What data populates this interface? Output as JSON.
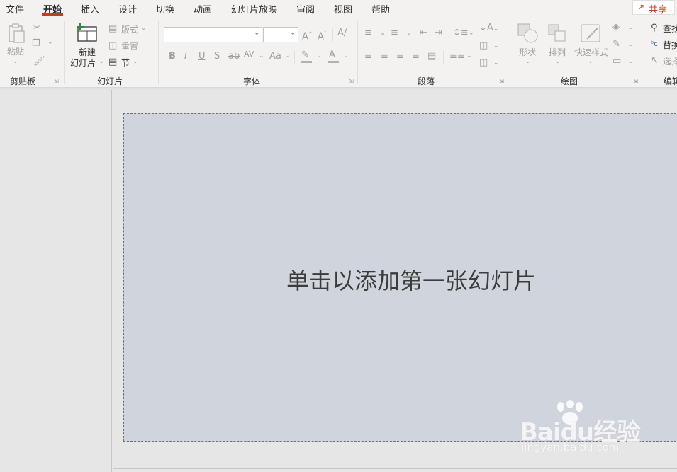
{
  "menu": {
    "tabs": [
      {
        "label": "文件"
      },
      {
        "label": "开始"
      },
      {
        "label": "插入"
      },
      {
        "label": "设计"
      },
      {
        "label": "切换"
      },
      {
        "label": "动画"
      },
      {
        "label": "幻灯片放映"
      },
      {
        "label": "审阅"
      },
      {
        "label": "视图"
      },
      {
        "label": "帮助"
      }
    ],
    "active_tab": "开始",
    "share_label": "共享",
    "accent_color": "#c43e1c"
  },
  "ribbon": {
    "clipboard": {
      "group_label": "剪贴板",
      "paste_label": "粘贴"
    },
    "slides": {
      "group_label": "幻灯片",
      "new_slide_line1": "新建",
      "new_slide_line2": "幻灯片",
      "layout_label": "版式",
      "reset_label": "重置",
      "section_label": "节"
    },
    "font": {
      "group_label": "字体",
      "font_name_value": "",
      "font_size_value": ""
    },
    "paragraph": {
      "group_label": "段落"
    },
    "drawing": {
      "group_label": "绘图",
      "shapes_label": "形状",
      "arrange_label": "排列",
      "quick_styles_label": "快速样式"
    },
    "editing": {
      "group_label": "编辑",
      "find_label": "查找",
      "replace_label": "替换",
      "select_label": "选择"
    }
  },
  "slide": {
    "placeholder": "单击以添加第一张幻灯片",
    "background_color": "#d0d4dc"
  },
  "watermark": {
    "brand": "Baidu经验",
    "url": "jingyan.baidu.com"
  }
}
